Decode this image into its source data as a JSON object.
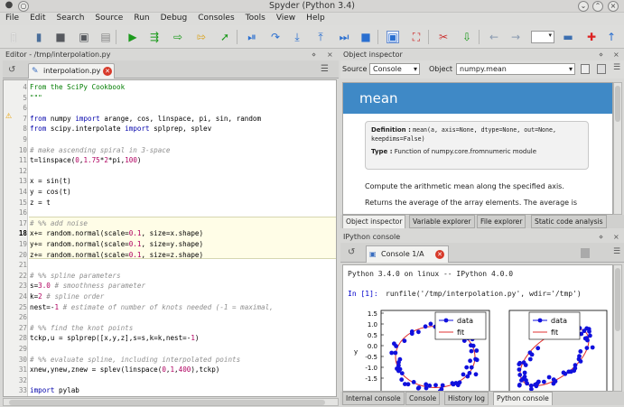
{
  "window": {
    "title": "Spyder (Python 3.4)"
  },
  "menu": [
    "File",
    "Edit",
    "Search",
    "Source",
    "Run",
    "Debug",
    "Consoles",
    "Tools",
    "View",
    "Help"
  ],
  "editor": {
    "pane_title": "Editor - /tmp/interpolation.py",
    "tab_label": "interpolation.py",
    "lines": [
      {
        "n": "4",
        "t": "From the SciPy Cookbook"
      },
      {
        "n": "5",
        "t": "\"\"\""
      },
      {
        "n": "6",
        "t": ""
      },
      {
        "n": "7",
        "t": "from numpy import arange, cos, linspace, pi, sin, random"
      },
      {
        "n": "8",
        "t": "from scipy.interpolate import splprep, splev"
      },
      {
        "n": "9",
        "t": ""
      },
      {
        "n": "10",
        "t": "# make ascending spiral in 3-space"
      },
      {
        "n": "11",
        "t": "t=linspace(0,1.75*2*pi,100)"
      },
      {
        "n": "12",
        "t": ""
      },
      {
        "n": "13",
        "t": "x = sin(t)"
      },
      {
        "n": "14",
        "t": "y = cos(t)"
      },
      {
        "n": "15",
        "t": "z = t"
      },
      {
        "n": "16",
        "t": ""
      },
      {
        "n": "17",
        "t": "# %% add noise"
      },
      {
        "n": "18",
        "t": "x+= random.normal(scale=0.1, size=x.shape)"
      },
      {
        "n": "19",
        "t": "y+= random.normal(scale=0.1, size=y.shape)"
      },
      {
        "n": "20",
        "t": "z+= random.normal(scale=0.1, size=z.shape)"
      },
      {
        "n": "21",
        "t": ""
      },
      {
        "n": "22",
        "t": "# %% spline parameters"
      },
      {
        "n": "23",
        "t": "s=3.0 # smoothness parameter"
      },
      {
        "n": "24",
        "t": "k=2 # spline order"
      },
      {
        "n": "25",
        "t": "nest=-1 # estimate of number of knots needed (-1 = maximal,"
      },
      {
        "n": "26",
        "t": ""
      },
      {
        "n": "27",
        "t": "# %% find the knot points"
      },
      {
        "n": "28",
        "t": "tckp,u = splprep([x,y,z],s=s,k=k,nest=-1)"
      },
      {
        "n": "29",
        "t": ""
      },
      {
        "n": "30",
        "t": "# %% evaluate spline, including interpolated points"
      },
      {
        "n": "31",
        "t": "xnew,ynew,znew = splev(linspace(0,1,400),tckp)"
      },
      {
        "n": "32",
        "t": ""
      },
      {
        "n": "33",
        "t": "import pylab"
      }
    ]
  },
  "inspector": {
    "pane_title": "Object inspector",
    "source_label": "Source",
    "source_value": "Console",
    "object_label": "Object",
    "object_value": "numpy.mean",
    "doc_title": "mean",
    "definition_label": "Definition :",
    "definition_text": "mean(a, axis=None, dtype=None, out=None, keepdims=False)",
    "type_label": "Type :",
    "type_text": "Function of numpy.core.fromnumeric module",
    "desc1": "Compute the arithmetic mean along the specified axis.",
    "desc2": "Returns the average of the array elements. The average is",
    "tabs": [
      "Object inspector",
      "Variable explorer",
      "File explorer",
      "Static code analysis"
    ]
  },
  "ipython": {
    "pane_title": "IPython console",
    "tab_label": "Console 1/A",
    "banner": "Python 3.4.0 on linux -- IPython 4.0.0",
    "prompt": "In [1]:",
    "command": "runfile('/tmp/interpolation.py', wdir='/tmp')",
    "tabs": [
      "Internal console",
      "Console",
      "History log",
      "Python console"
    ],
    "plot_ylabel": "y",
    "plot_yticks": [
      "1.5",
      "1.0",
      "0.5",
      "0.0",
      "-0.5",
      "-1.0",
      "-1.5"
    ],
    "legend": [
      "data",
      "fit"
    ]
  },
  "colors": {
    "accent": "#3f89c6",
    "data": "#1010dd",
    "fit": "#e03030"
  }
}
